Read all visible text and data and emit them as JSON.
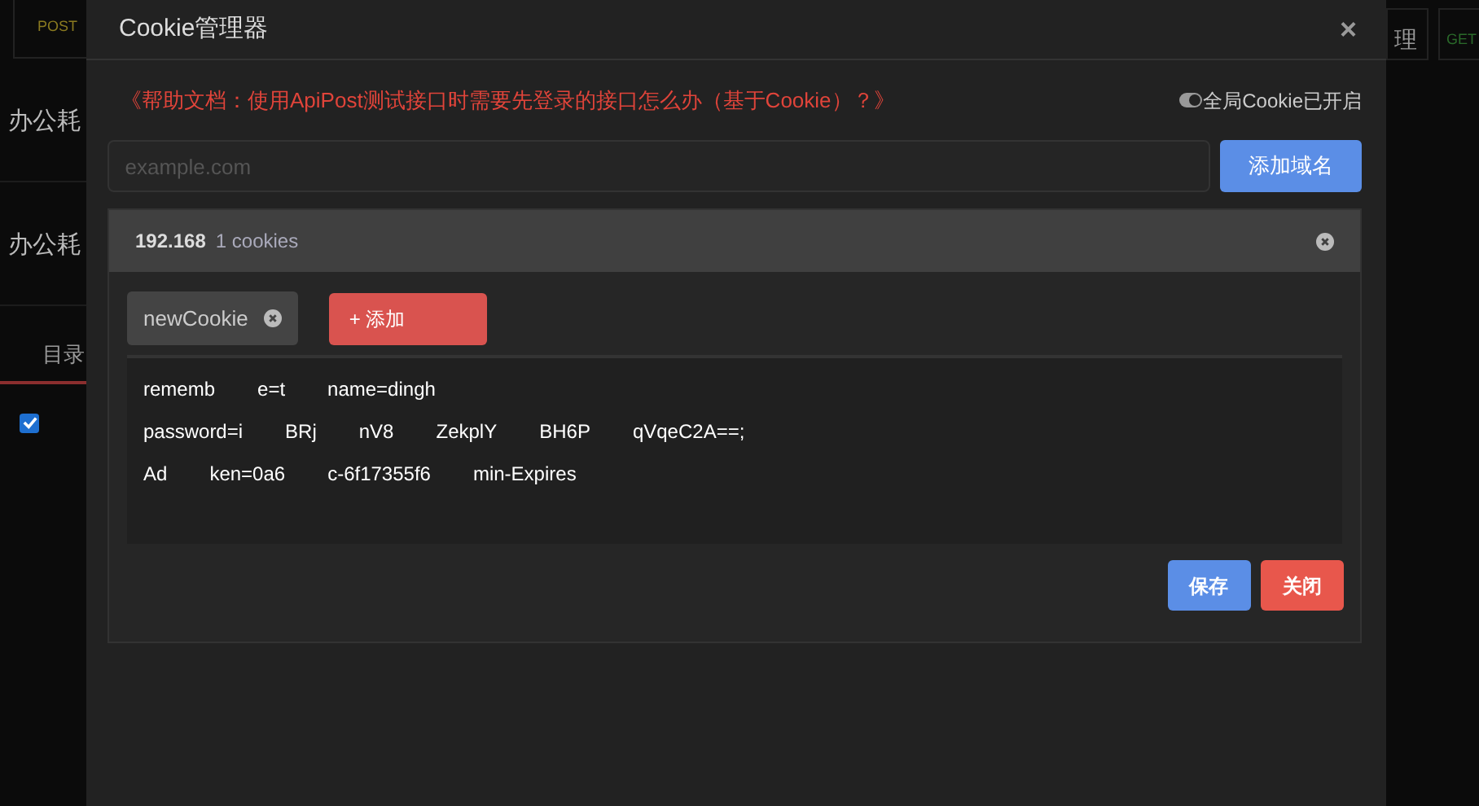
{
  "background": {
    "left_tab": "POST",
    "left_rows": [
      "办公耗",
      "办公耗"
    ],
    "left_tab_label": "目录",
    "left_checkbox_checked": true,
    "right_tab": "理",
    "right_method": "GET"
  },
  "dialog": {
    "title": "Cookie管理器",
    "close": "×",
    "help_link": "《帮助文档：使用ApiPost测试接口时需要先登录的接口怎么办（基于Cookie）？》",
    "global_cookie": {
      "label": "全局Cookie已开启",
      "on": true
    },
    "domain_input": {
      "placeholder": "example.com"
    },
    "add_domain_button": "添加域名",
    "domains": [
      {
        "name": "192.168",
        "count": "1 cookies",
        "cookies": [
          {
            "name": "newCookie"
          }
        ],
        "add_cookie_button": "+ 添加",
        "lines": [
          [
            "rememb",
            "e=t",
            "name=dingh"
          ],
          [
            "password=i",
            "BRj",
            "nV8",
            "ZekplY",
            "BH6P",
            "qVqeC2A==;"
          ],
          [
            "Ad",
            "ken=0a6",
            "c-6f17355f6",
            "min-Expires"
          ]
        ],
        "buttons": [
          {
            "label": "保存",
            "kind": "primary"
          },
          {
            "label": "关闭",
            "kind": "danger"
          }
        ]
      }
    ]
  }
}
